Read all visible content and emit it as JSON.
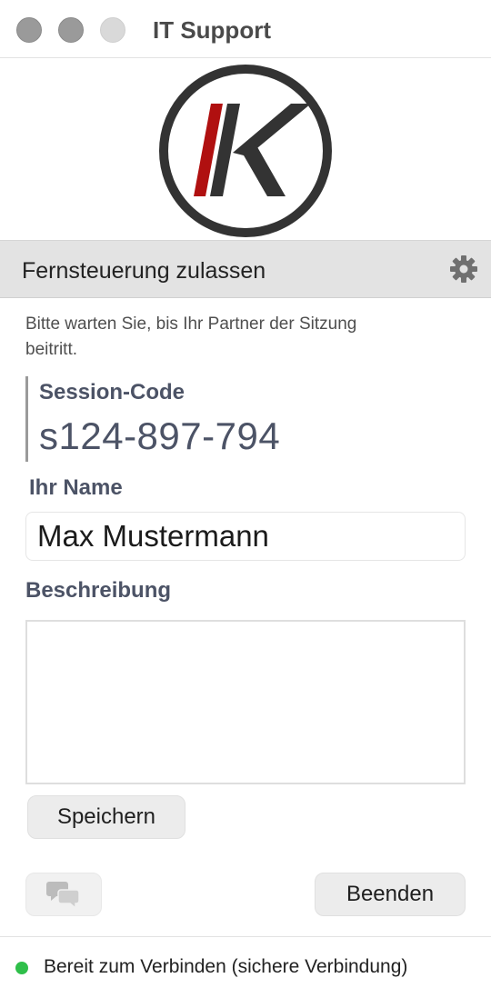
{
  "window": {
    "title": "IT Support"
  },
  "logo": {
    "name": "ik-logo-icon"
  },
  "section": {
    "title": "Fernsteuerung zulassen",
    "settings_icon": "gear-icon"
  },
  "hint": "Bitte warten Sie, bis Ihr Partner der Sitzung beitritt.",
  "session": {
    "label": "Session-Code",
    "code": "s124-897-794"
  },
  "name_field": {
    "label": "Ihr Name",
    "value": "Max Mustermann"
  },
  "description_field": {
    "label": "Beschreibung",
    "value": ""
  },
  "buttons": {
    "save": "Speichern",
    "chat_icon": "chat-bubbles-icon",
    "end": "Beenden"
  },
  "status": {
    "text": "Bereit zum Verbinden (sichere Verbindung)",
    "color": "#2fbf4a"
  },
  "colors": {
    "accent_red": "#b01010",
    "logo_dark": "#333333",
    "label_color": "#4c5366"
  }
}
